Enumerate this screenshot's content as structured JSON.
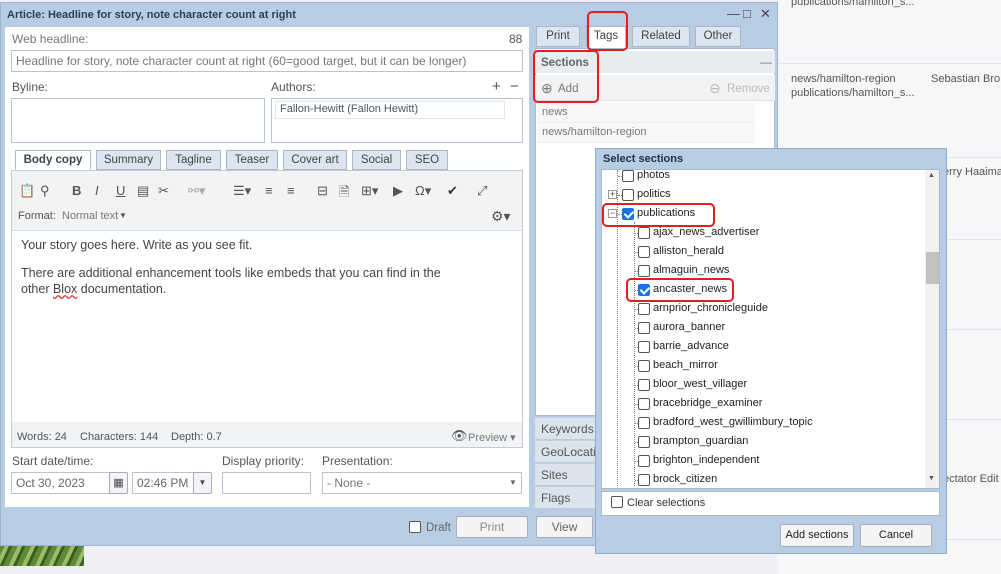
{
  "background": {
    "rows": [
      {
        "path1": "publications/hamilton_s..."
      },
      {
        "path1": "news/hamilton-region",
        "author": "Sebastian Bro",
        "path2": "publications/hamilton_s..."
      },
      {
        "author": "erry Haaima"
      },
      {
        "author": "ectator Edit"
      }
    ]
  },
  "dialog": {
    "title": "Article: Headline for story, note character count at right",
    "web_headline_label": "Web headline:",
    "char_count": "88",
    "headline_value": "Headline for story, note character count at right (60=good target, but it can be longer)",
    "byline_label": "Byline:",
    "authors_label": "Authors:",
    "author_value": "Fallon-Hewitt (Fallon Hewitt)",
    "editor_tabs": [
      "Body copy",
      "Summary",
      "Tagline",
      "Teaser",
      "Cover art",
      "Social",
      "SEO"
    ],
    "format_label": "Format:",
    "format_value": "Normal text",
    "body_p1": "Your story goes here. Write as you see fit.",
    "body_p2a": "There are additional enhancement tools like embeds that you can find in the",
    "body_p2b_pre": "other ",
    "body_p2b_word": "Blox",
    "body_p2b_post": " documentation.",
    "stats": {
      "words": "Words: 24",
      "characters": "Characters: 144",
      "depth": "Depth: 0.7"
    },
    "preview_label": "Preview",
    "start_label": "Start date/time:",
    "date_value": "Oct 30, 2023",
    "time_value": "02:46 PM",
    "priority_label": "Display priority:",
    "presentation_label": "Presentation:",
    "presentation_value": "- None -",
    "draft_label": "Draft",
    "print_button": "Print",
    "view_button": "View"
  },
  "side": {
    "tabs": [
      "Print",
      "Tags",
      "Related",
      "Other"
    ],
    "sections_label": "Sections",
    "add_label": "Add",
    "remove_label": "Remove",
    "section_items": [
      "news",
      "news/hamilton-region"
    ],
    "accordion": [
      "Keywords",
      "GeoLocatio",
      "Sites",
      "Flags"
    ]
  },
  "popup": {
    "title": "Select sections",
    "nodes": [
      {
        "label": "photos",
        "checked": false,
        "level": 0
      },
      {
        "label": "politics",
        "checked": false,
        "level": 0
      },
      {
        "label": "publications",
        "checked": true,
        "level": 0
      },
      {
        "label": "ajax_news_advertiser",
        "checked": false,
        "level": 1
      },
      {
        "label": "alliston_herald",
        "checked": false,
        "level": 1
      },
      {
        "label": "almaguin_news",
        "checked": false,
        "level": 1
      },
      {
        "label": "ancaster_news",
        "checked": true,
        "level": 1
      },
      {
        "label": "arnprior_chronicleguide",
        "checked": false,
        "level": 1
      },
      {
        "label": "aurora_banner",
        "checked": false,
        "level": 1
      },
      {
        "label": "barrie_advance",
        "checked": false,
        "level": 1
      },
      {
        "label": "beach_mirror",
        "checked": false,
        "level": 1
      },
      {
        "label": "bloor_west_villager",
        "checked": false,
        "level": 1
      },
      {
        "label": "bracebridge_examiner",
        "checked": false,
        "level": 1
      },
      {
        "label": "bradford_west_gwillimbury_topic",
        "checked": false,
        "level": 1
      },
      {
        "label": "brampton_guardian",
        "checked": false,
        "level": 1
      },
      {
        "label": "brighton_independent",
        "checked": false,
        "level": 1
      },
      {
        "label": "brock_citizen",
        "checked": false,
        "level": 1
      }
    ],
    "clear_label": "Clear selections",
    "add_button": "Add sections",
    "cancel_button": "Cancel"
  }
}
